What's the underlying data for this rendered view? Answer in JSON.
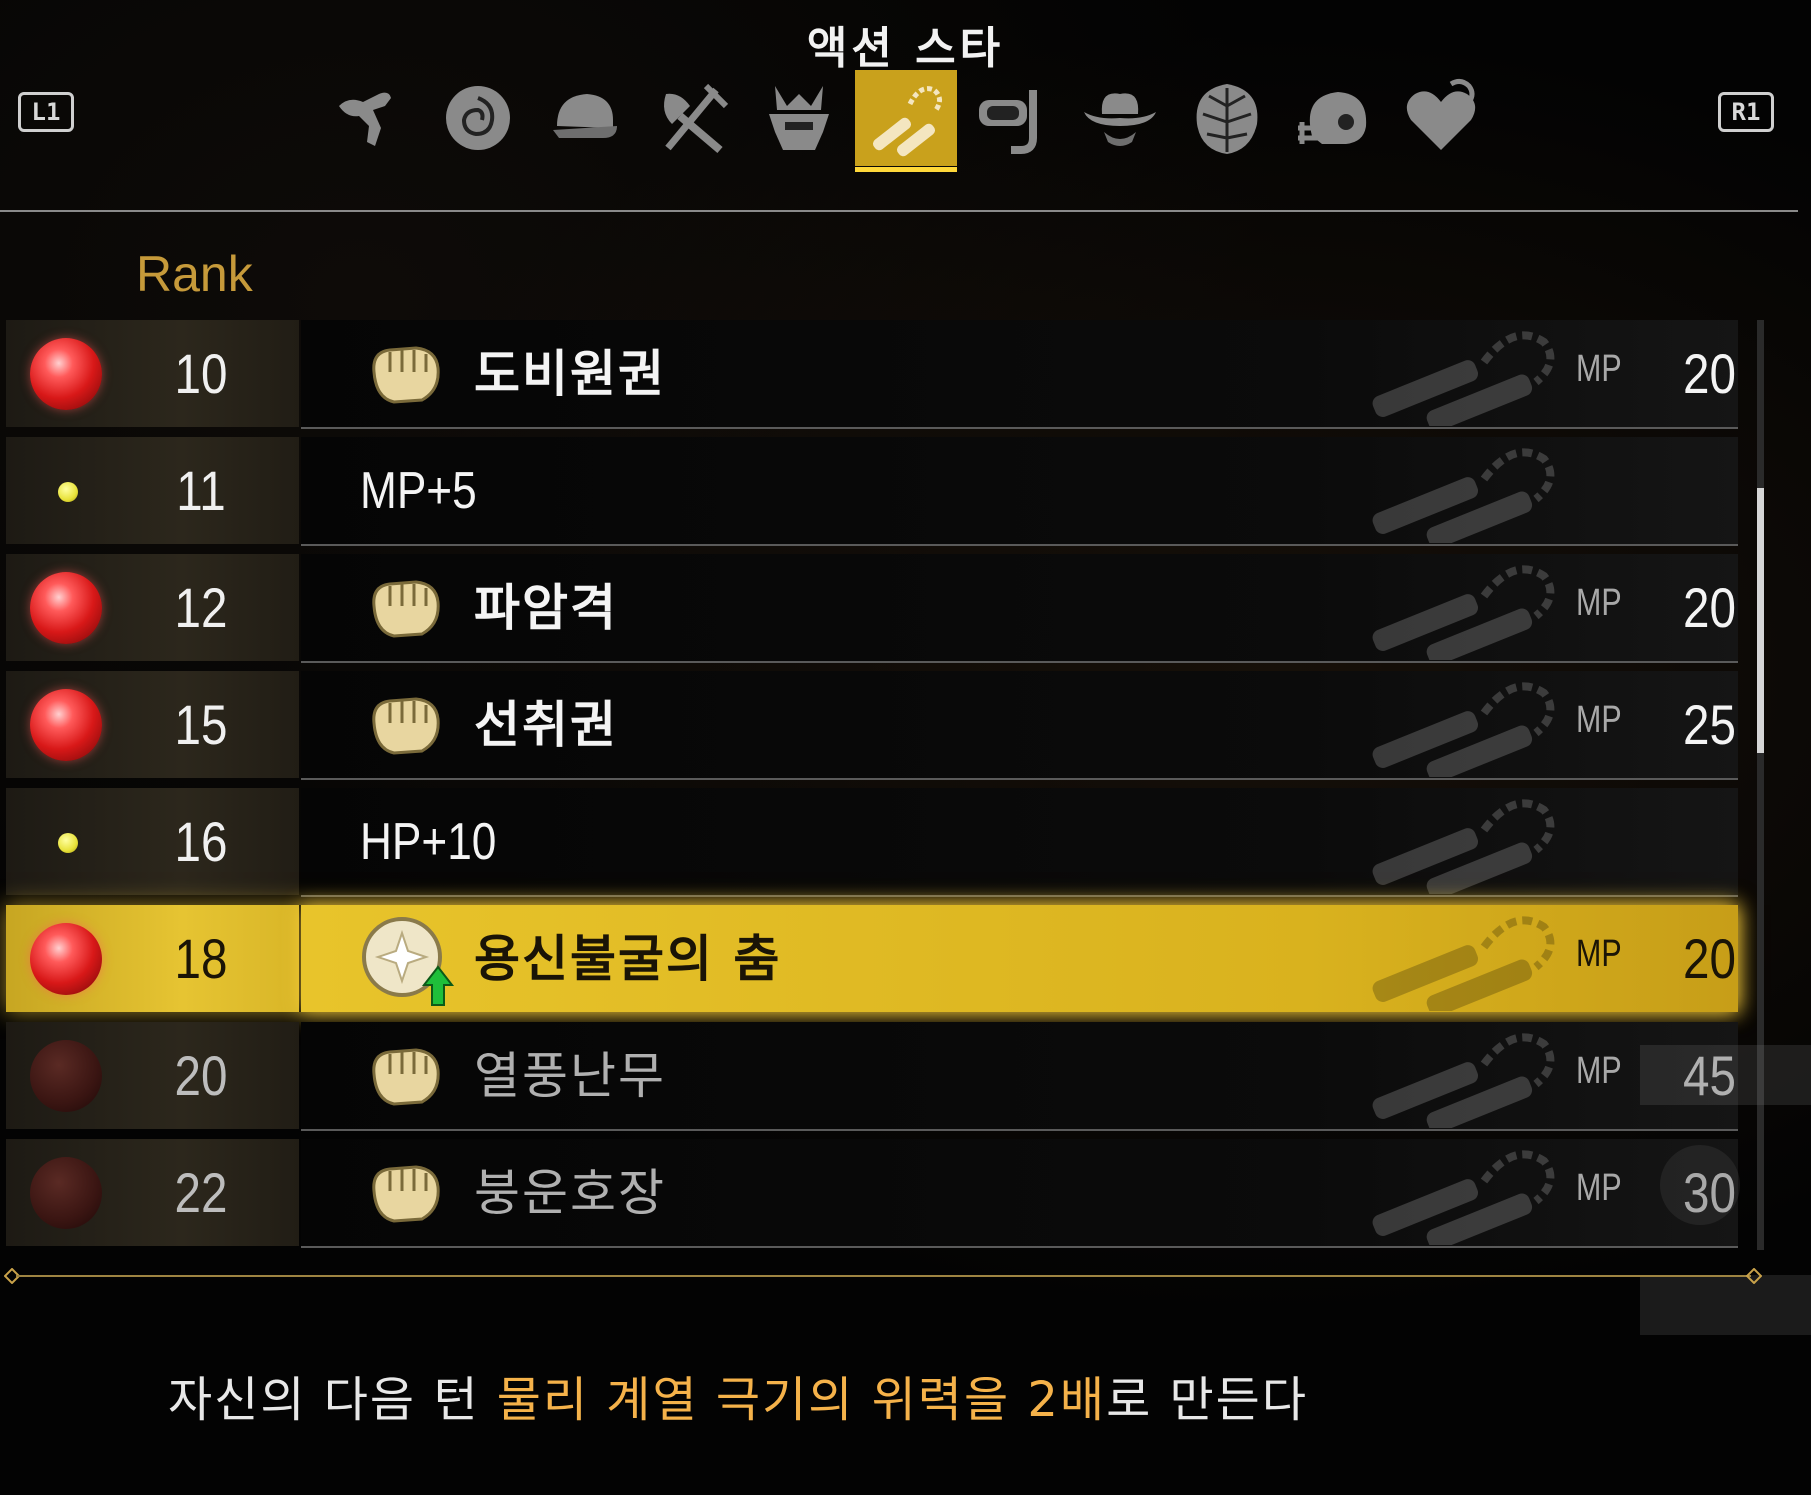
{
  "title": "액션 스타",
  "shoulder_left": "L1",
  "shoulder_right": "R1",
  "tabs": [
    {
      "icon": "kick-icon",
      "active": false
    },
    {
      "icon": "rose-icon",
      "active": false
    },
    {
      "icon": "cap-icon",
      "active": false
    },
    {
      "icon": "chef-utensils-icon",
      "active": false
    },
    {
      "icon": "samurai-helmet-icon",
      "active": false
    },
    {
      "icon": "nunchaku-icon",
      "active": true
    },
    {
      "icon": "snorkel-icon",
      "active": false
    },
    {
      "icon": "cowboy-hat-icon",
      "active": false
    },
    {
      "icon": "palm-leaf-icon",
      "active": false
    },
    {
      "icon": "football-helmet-icon",
      "active": false
    },
    {
      "icon": "heart-icon",
      "active": false
    }
  ],
  "rank_header": "Rank",
  "rows": [
    {
      "rank": "10",
      "kind": "skill",
      "name": "도비원권",
      "mp_label": "MP",
      "mp": "20",
      "state": "unlocked",
      "icon": "fist-icon"
    },
    {
      "rank": "11",
      "kind": "stat",
      "name": "MP+5",
      "state": "unlocked"
    },
    {
      "rank": "12",
      "kind": "skill",
      "name": "파암격",
      "mp_label": "MP",
      "mp": "20",
      "state": "unlocked",
      "icon": "fist-icon"
    },
    {
      "rank": "15",
      "kind": "skill",
      "name": "선취권",
      "mp_label": "MP",
      "mp": "25",
      "state": "unlocked",
      "icon": "fist-icon"
    },
    {
      "rank": "16",
      "kind": "stat",
      "name": "HP+10",
      "state": "unlocked"
    },
    {
      "rank": "18",
      "kind": "skill",
      "name": "용신불굴의 춤",
      "mp_label": "MP",
      "mp": "20",
      "state": "selected",
      "icon": "buff-up-icon"
    },
    {
      "rank": "20",
      "kind": "skill",
      "name": "열풍난무",
      "mp_label": "MP",
      "mp": "45",
      "state": "locked",
      "icon": "fist-icon"
    },
    {
      "rank": "22",
      "kind": "skill",
      "name": "붕운호장",
      "mp_label": "MP",
      "mp": "30",
      "state": "locked",
      "icon": "fist-icon"
    }
  ],
  "description": {
    "part1": "자신의 다음 턴 ",
    "highlight1": "물리 계열 극기의 위력을 2배",
    "part2": "로 만든다"
  },
  "colors": {
    "accent_gold": "#d9b21e",
    "highlight_text": "#f5b24a",
    "rank_header": "#c69a3a"
  }
}
